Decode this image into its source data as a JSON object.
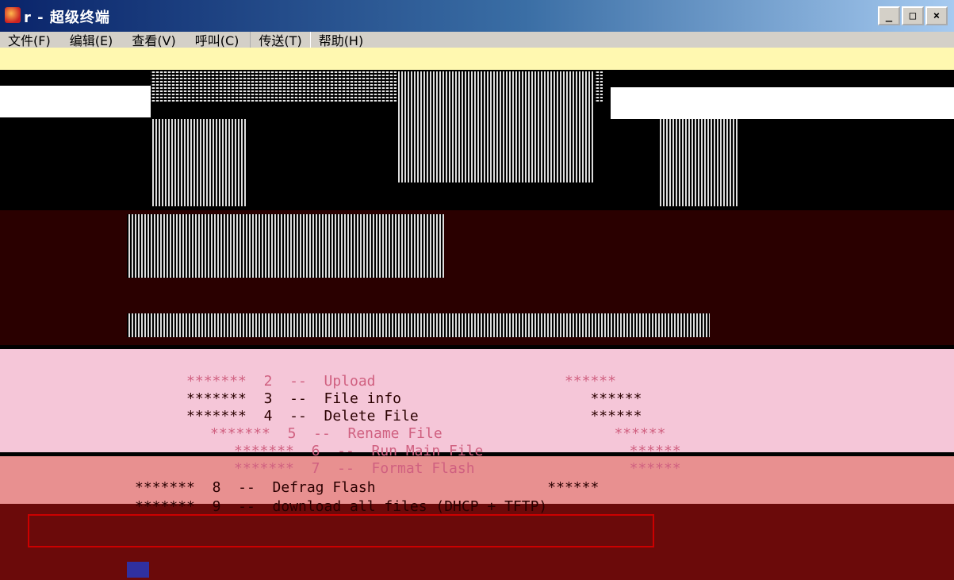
{
  "window": {
    "title": "r - 超级终端",
    "buttons": {
      "minimize": "_",
      "maximize": "□",
      "close": "×"
    }
  },
  "menu": {
    "items": [
      "文件(F)",
      "编辑(E)",
      "查看(V)",
      "呼叫(C)",
      "传送(T)",
      "帮助(H)"
    ],
    "active_index": 4
  },
  "terminal": {
    "lines": [
      {
        "stars": "*******",
        "num": "2",
        "sep": "--",
        "label": "Upload",
        "end": "******"
      },
      {
        "stars": "*******",
        "num": "3",
        "sep": "--",
        "label": "File info",
        "end": "******"
      },
      {
        "stars": "*******",
        "num": "4",
        "sep": "--",
        "label": "Delete File",
        "end": "******"
      },
      {
        "stars": "*******",
        "num": "5",
        "sep": "--",
        "label": "Rename File",
        "end": "******"
      },
      {
        "stars": "*******",
        "num": "6",
        "sep": "--",
        "label": "Run Main File",
        "end": "******"
      },
      {
        "stars": "*******",
        "num": "7",
        "sep": "--",
        "label": "Format Flash",
        "end": "******"
      },
      {
        "stars": "*******",
        "num": "8",
        "sep": "--",
        "label": "Defrag Flash",
        "end": "******"
      },
      {
        "stars": "*******",
        "num": "9",
        "sep": "--",
        "label": "download all files (DHCP + TFTP)",
        "end": ""
      }
    ]
  },
  "colors": {
    "title_start": "#0a246a",
    "title_end": "#a6caf0",
    "menu_bg": "#d4d0c8",
    "term_bg": "#000000",
    "band_pink": "#f5c6d8",
    "band_salmon": "#e89090",
    "band_maroon": "#6b0a0a",
    "text_pink": "#d06080",
    "text_dark": "#2a0000"
  }
}
